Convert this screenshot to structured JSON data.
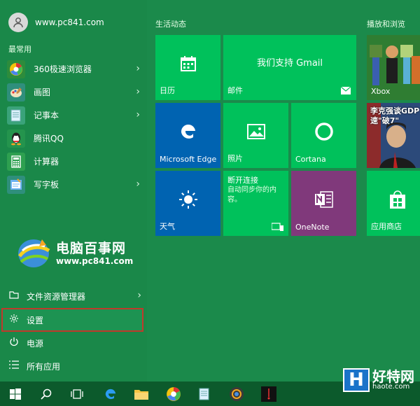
{
  "user": {
    "name": "www.pc841.com"
  },
  "most_used_label": "最常用",
  "apps": [
    {
      "label": "360极速浏览器",
      "icon": "360-browser-icon",
      "color": "#2d8c3c",
      "has_arrow": true
    },
    {
      "label": "画图",
      "icon": "paint-icon",
      "color": "#2f8f7c",
      "has_arrow": true
    },
    {
      "label": "记事本",
      "icon": "notepad-icon",
      "color": "#3aa37a",
      "has_arrow": true
    },
    {
      "label": "腾讯QQ",
      "icon": "qq-icon",
      "color": "#24944d",
      "has_arrow": false
    },
    {
      "label": "计算器",
      "icon": "calculator-icon",
      "color": "#2ea050",
      "has_arrow": false
    },
    {
      "label": "写字板",
      "icon": "wordpad-icon",
      "color": "#2f8f7c",
      "has_arrow": true
    }
  ],
  "watermark": {
    "title": "电脑百事网",
    "url": "www.pc841.com"
  },
  "bottom": {
    "explorer": "文件资源管理器",
    "settings": "设置",
    "power": "电源",
    "all_apps": "所有应用"
  },
  "groups": {
    "life": "生活动态",
    "play": "播放和浏览"
  },
  "tiles": {
    "calendar": "日历",
    "mail_title": "我们支持 Gmail",
    "mail": "邮件",
    "edge": "Microsoft Edge",
    "photos": "照片",
    "cortana": "Cortana",
    "weather": "天气",
    "disconnect_title": "断开连接",
    "disconnect_body": "自动同步你的内容。",
    "onenote": "OneNote",
    "xbox": "Xbox",
    "news": "李克强谈GDP速\"破7\"",
    "store": "应用商店"
  },
  "colors": {
    "bg": "#1b8a4b",
    "tile_green": "#00c15b",
    "tile_blue": "#0063b1",
    "tile_purple": "#80397b",
    "highlight": "#c0392b"
  },
  "branding": {
    "cn": "好特网",
    "url": "haote.com"
  }
}
